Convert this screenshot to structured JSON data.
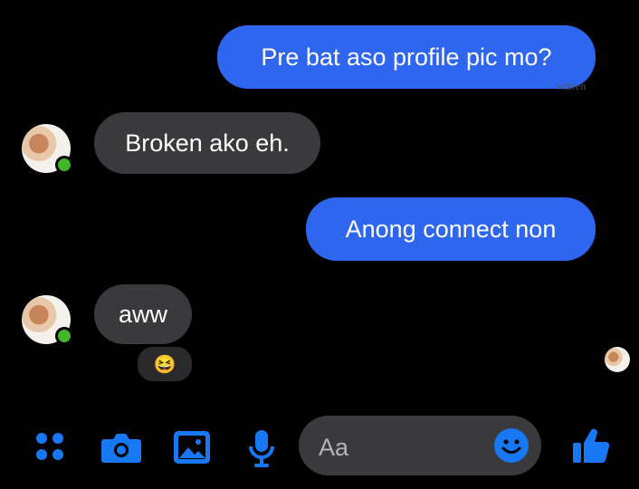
{
  "messages": [
    {
      "side": "sent",
      "text": "Pre bat aso profile pic mo?"
    },
    {
      "side": "received",
      "text": "Broken ako eh."
    },
    {
      "side": "sent",
      "text": "Anong connect non"
    },
    {
      "side": "received",
      "text": "aww"
    }
  ],
  "reaction": {
    "emoji": "😆"
  },
  "composer": {
    "placeholder": "Aa"
  },
  "watermark": "wittren",
  "colors": {
    "sent": "#2f66f0",
    "received": "#3a3a3c",
    "accent": "#1877f2",
    "background": "#000000"
  },
  "toolbar": {
    "icons": [
      "menu-icon",
      "camera-icon",
      "gallery-icon",
      "microphone-icon",
      "emoji-icon",
      "thumbs-up-icon"
    ]
  }
}
